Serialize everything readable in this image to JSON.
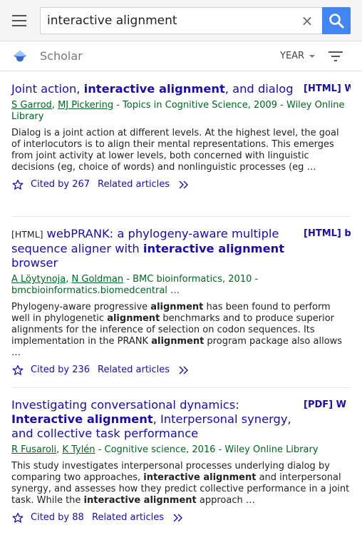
{
  "search": {
    "query": "interactive alignment",
    "clear_symbol": "×"
  },
  "header": {
    "brand": "Scholar",
    "year_label": "YEAR"
  },
  "colors": {
    "link": "#1a0dab",
    "author": "#006621",
    "search_button": "#4285f4"
  },
  "results": [
    {
      "title_parts": [
        "Joint action, ",
        "interactive alignment",
        ", and dialog"
      ],
      "side_link": "[HTML] W",
      "authors": [
        "S Garrod",
        "MJ Pickering"
      ],
      "source": " - Topics in Cognitive Science, 2009 - Wiley Online Library",
      "snippet": "Dialog is a joint action at different levels. At the highest level, the goal of interlocutors is to align their mental representations. This emerges from joint activity at lower levels, both concerned with linguistic decisions (eg, choice of words) and nonlinguistic processes (eg …",
      "cited_by": "Cited by 267",
      "related": "Related articles"
    },
    {
      "type_tag": "[HTML]",
      "title_parts": [
        "webPRANK: a phylogeny-aware multiple sequence aligner with ",
        "interactive alignment",
        " browser"
      ],
      "side_link": "[HTML] b",
      "authors": [
        "A Löytynoja",
        "N Goldman"
      ],
      "source": " - BMC bioinformatics, 2010 - bmcbioinformatics.biomedcentral …",
      "snippet_parts": [
        "Phylogeny-aware progressive ",
        "alignment",
        " has been found to perform well in phylogenetic ",
        "alignment",
        " benchmarks and to produce superior alignments for the inference of selection on codon sequences. Its implementation in the PRANK ",
        "alignment",
        " program package also allows …"
      ],
      "cited_by": "Cited by 236",
      "related": "Related articles"
    },
    {
      "title_parts": [
        "Investigating conversational dynamics: ",
        "Interactive alignment",
        ", Interpersonal synergy, and collective task performance"
      ],
      "side_link": "[PDF] W",
      "authors": [
        "R Fusaroli",
        "K Tylén"
      ],
      "source": " - Cognitive science, 2016 - Wiley Online Library",
      "snippet_parts": [
        "This study investigates interpersonal processes underlying dialog by comparing two approaches, ",
        "interactive alignment",
        " and interpersonal synergy, and assesses how they predict collective performance in a joint task. While the ",
        "interactive alignment",
        " approach …"
      ],
      "cited_by": "Cited by 88",
      "related": "Related articles"
    }
  ]
}
